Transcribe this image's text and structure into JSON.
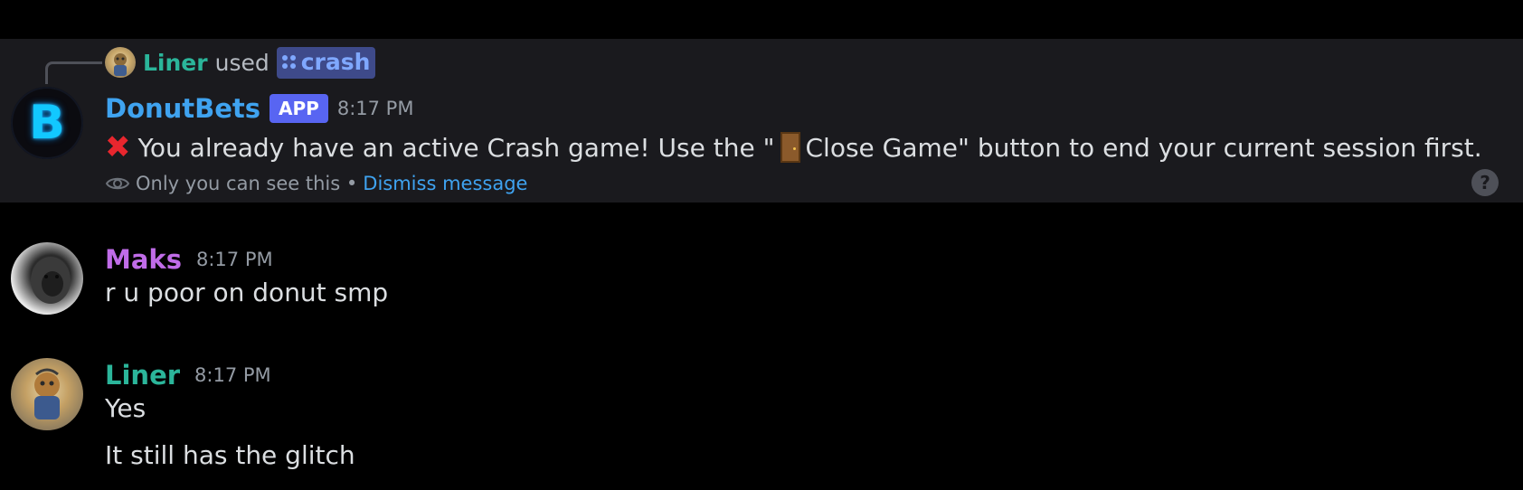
{
  "colors": {
    "background": "#000000",
    "ephemeral_bg": "#1a1a1e",
    "bot_name": "#3fa3f0",
    "app_badge": "#5865f2",
    "liner_name": "#2bb59a",
    "maks_name": "#c06ce8",
    "link": "#3fa3f0",
    "muted": "#949ba4"
  },
  "ephemeral_message": {
    "reply": {
      "user": "Liner",
      "used_text": "used",
      "command": "crash",
      "command_icon": "slash-command-icon"
    },
    "author": "DonutBets",
    "badge": "APP",
    "timestamp": "8:17 PM",
    "body_prefix_icon": "cross-mark-icon",
    "body_part1": "You already have an active Crash game! Use the \"",
    "body_icon": "door-icon",
    "body_part2": " Close Game\" button to end your current session first.",
    "footer_text": "Only you can see this •",
    "dismiss_label": "Dismiss message",
    "eye_icon": "eye-icon",
    "help_icon": "help-icon",
    "help_glyph": "?"
  },
  "messages": [
    {
      "author": "Maks",
      "timestamp": "8:17 PM",
      "lines": [
        "r u poor on donut smp"
      ]
    },
    {
      "author": "Liner",
      "timestamp": "8:17 PM",
      "lines": [
        "Yes",
        "It still has the glitch"
      ]
    }
  ]
}
